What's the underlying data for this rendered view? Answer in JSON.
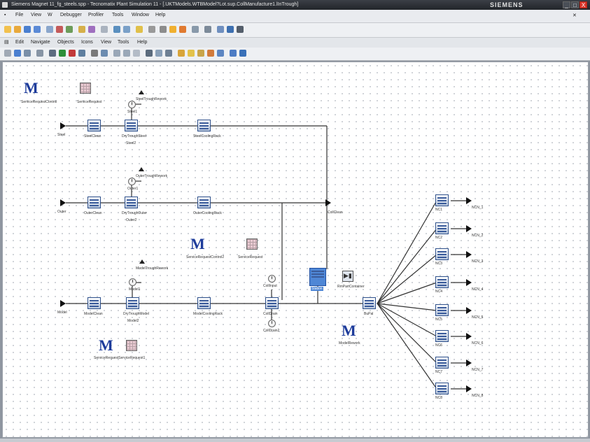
{
  "window": {
    "title": "Siemens Magnet 11_fg_steels.spp - Tecnomatix Plant Simulation 11 - [.UKTModels.WTBModel?Lot.sup.CollManufacture1.lInTrough]",
    "brand": "SIEMENS",
    "buttons": {
      "minimize": "_",
      "maximize": "□",
      "close": "X"
    }
  },
  "menubar_main": [
    "File",
    "View",
    "W",
    "Debugger",
    "Profiler",
    "Tools",
    "Window",
    "Help"
  ],
  "menubar_frame": [
    "Edit",
    "Navigate",
    "Objects",
    "Icons",
    "View",
    "Tools",
    "Help"
  ],
  "colors": {
    "title_bg": "#2a2d33",
    "canvas_bg": "#ffffff",
    "station_border": "#2d4f8a",
    "selected": "#4f87d6",
    "close_btn": "#d9352a"
  },
  "canvas": {
    "frame_objects": [
      {
        "kind": "method",
        "label": "ServiceRequestControl"
      },
      {
        "kind": "table",
        "label": "ServiceRequest"
      },
      {
        "kind": "method",
        "label": "ServiceRequestControl2"
      },
      {
        "kind": "table",
        "label": "ServiceRequest"
      },
      {
        "kind": "method",
        "label": "ServiceRequestServiceRequest1"
      },
      {
        "kind": "method",
        "label": "ModelRework"
      }
    ],
    "lines": [
      {
        "source": "Steel",
        "station1": "SteelClean",
        "station2": "DryTroughSteel",
        "drain": "Steel1",
        "drain_label": "SteelTroughRework",
        "drain2": "Steel2",
        "station3": "SteelCoolingRack"
      },
      {
        "source": "Outer",
        "station1": "OuterClean",
        "station2": "DryTroughOuter",
        "drain": "Outer1",
        "drain_label": "OuterTroughRework",
        "drain2": "Outer2",
        "station3": "OuterCoolingRack"
      },
      {
        "source": "Model",
        "station1": "ModelClean",
        "station2": "DryTroughModel",
        "drain": "Model1",
        "drain_label": "ModelTroughRework",
        "drain2": "Model2",
        "station3": "ModelCoolingRack"
      }
    ],
    "merge": {
      "coll_clean": "CollClean",
      "coll_input": "CollInput",
      "coll_drain": "CollDrain",
      "coll_drain2": "CollDrain2"
    },
    "selected_station": "Station",
    "pack_label": "RmPartContainer",
    "buffer": "BuPal",
    "outputs": [
      {
        "station": "NC1",
        "sink": "NCN_1"
      },
      {
        "station": "NC2",
        "sink": "NCN_2"
      },
      {
        "station": "NC3",
        "sink": "NCN_3"
      },
      {
        "station": "NC4",
        "sink": "NCN_4"
      },
      {
        "station": "NC5",
        "sink": "NCN_5"
      },
      {
        "station": "NC6",
        "sink": "NCN_6"
      },
      {
        "station": "NC7",
        "sink": "NCN_7"
      },
      {
        "station": "NC8",
        "sink": "NCN_8"
      }
    ]
  }
}
